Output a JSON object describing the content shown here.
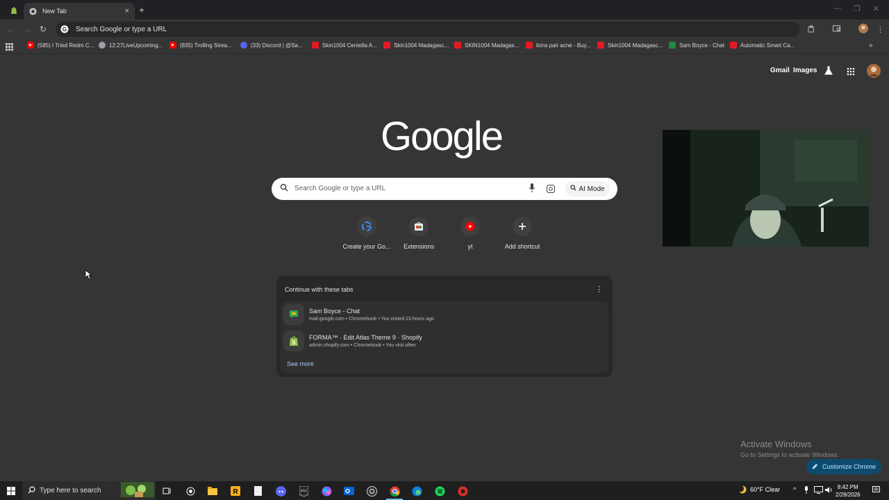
{
  "tab": {
    "title": "New Tab",
    "close": "×",
    "new_tab": "+"
  },
  "window": {
    "minimize": "—",
    "restore": "❐",
    "close": "✕"
  },
  "toolbar": {
    "back": "←",
    "forward": "→",
    "reload": "↻",
    "omnibox_text": "Search Google or type a URL"
  },
  "bookmarks": [
    {
      "label": "(585) I Tried Redm C...",
      "icon": "youtube-icon"
    },
    {
      "label": "12:27LiveUpcoming...",
      "icon": "globe-icon"
    },
    {
      "label": "(835) Trolling Strea...",
      "icon": "youtube-icon"
    },
    {
      "label": "(33) Discord | @Sa...",
      "icon": "discord-icon"
    },
    {
      "label": "Skin1004 Centella A...",
      "icon": "shop-icon"
    },
    {
      "label": "Skin1004 Madagasc...",
      "icon": "shop-icon"
    },
    {
      "label": "SKIN1004 Madagas...",
      "icon": "shop-icon"
    },
    {
      "label": "lions pair acne - Buy...",
      "icon": "shop-icon"
    },
    {
      "label": "Skin1004 Madagasc...",
      "icon": "shop-icon"
    },
    {
      "label": "Sam Boyce - Chat",
      "icon": "chat-icon"
    },
    {
      "label": "Automatic Smart Ca...",
      "icon": "shop-icon"
    }
  ],
  "bookmarks_overflow": "»",
  "header": {
    "gmail": "Gmail",
    "images": "Images"
  },
  "logo": "Google",
  "search": {
    "placeholder": "Search Google or type a URL",
    "ai_mode": "AI Mode"
  },
  "shortcuts": [
    {
      "label": "Create your Go...",
      "icon": "google-icon"
    },
    {
      "label": "Extensions",
      "icon": "webstore-icon"
    },
    {
      "label": "yt",
      "icon": "youtube-icon"
    },
    {
      "label": "Add shortcut",
      "icon": "plus-icon"
    }
  ],
  "continue": {
    "title": "Continue with these tabs",
    "items": [
      {
        "title": "Sam Boyce - Chat",
        "subtitle": "mail.google.com • Chromebook • You visited 23 hours ago",
        "icon": "google-chat-icon"
      },
      {
        "title": "FORMA™ · Edit Atlas Theme 9 · Shopify",
        "subtitle": "admin.shopify.com • Chromebook • You visit often",
        "icon": "shopify-icon"
      }
    ],
    "see_more": "See more"
  },
  "activate": {
    "line1": "Activate Windows",
    "line2": "Go to Settings to activate Windows."
  },
  "customize": "Customize Chrome",
  "taskbar": {
    "search_placeholder": "Type here to search",
    "weather": "60°F  Clear",
    "time": "8:42 PM",
    "date": "2/28/2026"
  },
  "colors": {
    "bg": "#353535",
    "accent_link": "#a8c7fa",
    "customize_bg": "#0c4a6e"
  }
}
